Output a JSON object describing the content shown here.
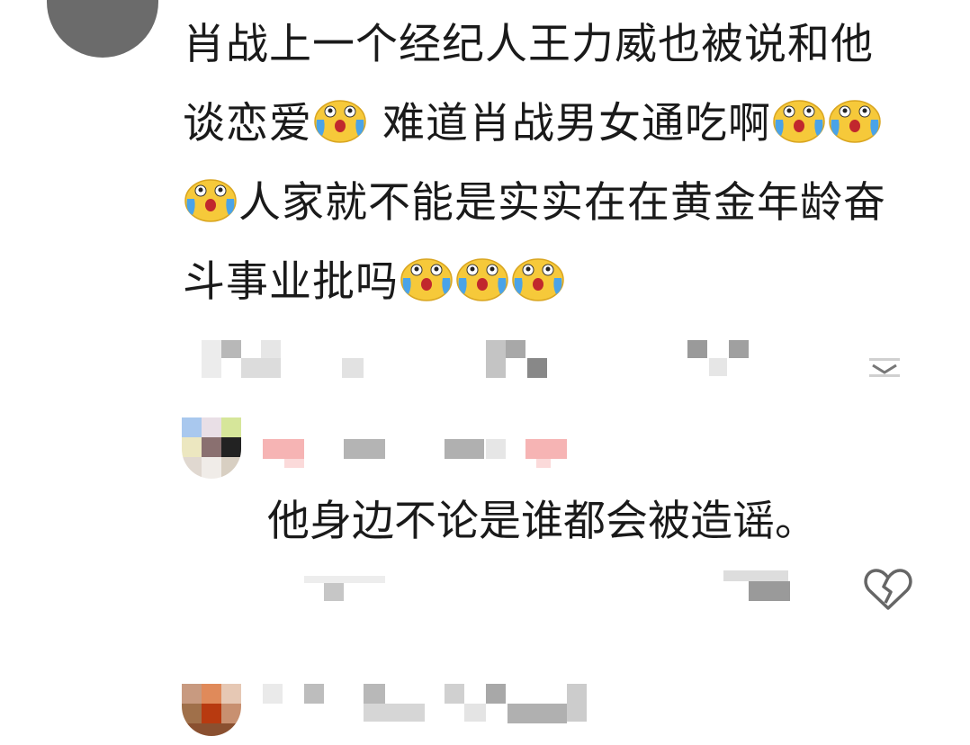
{
  "comment": {
    "line1": "肖战上一个经纪人王力威也被说和他",
    "line2_a": "谈恋爱",
    "line2_b": " 难道肖战男女通吃啊",
    "line3": "人家就不能是实实在在黄金年龄奋",
    "line4": "斗事业批吗"
  },
  "reply": {
    "text": "他身边不论是谁都会被造谣。"
  },
  "icons": {
    "emoji": "crying-laughing-emoji-icon",
    "heart": "broken-heart-icon",
    "chevron": "chevron-down-icon"
  },
  "colors": {
    "text": "#1a1a1a",
    "emoji_face": "#f6c93a",
    "emoji_tear": "#4aa3e8",
    "heart_stroke": "#666666",
    "blur_gray": "#bdbdbd",
    "blur_pink": "#f4a8a8"
  }
}
